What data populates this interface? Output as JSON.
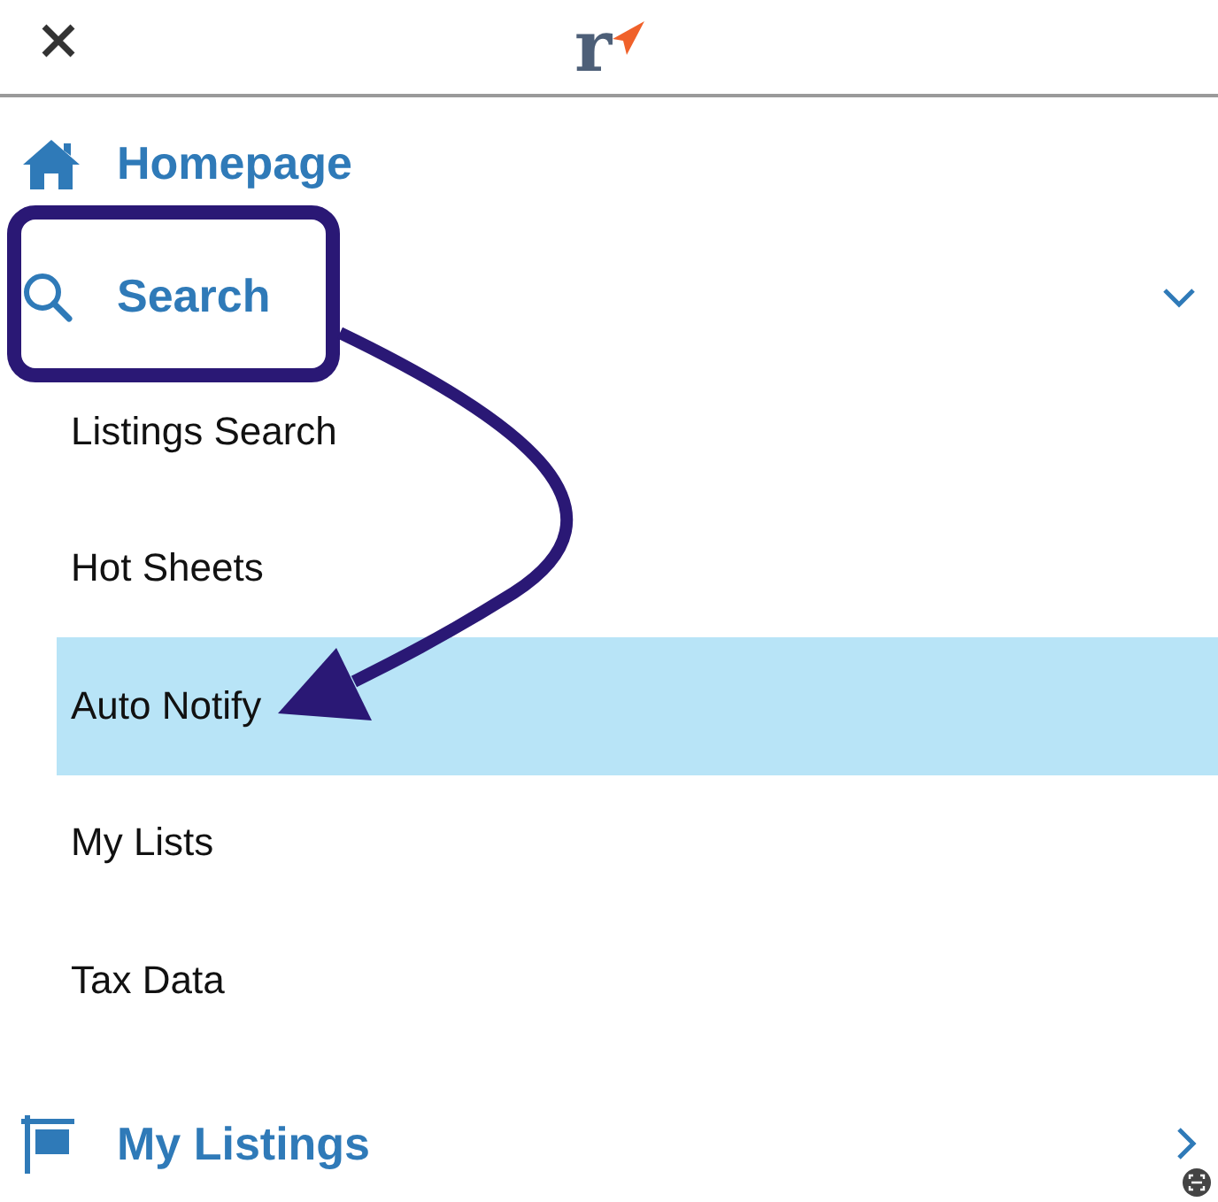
{
  "header": {
    "logo_text": "r"
  },
  "menu": [
    {
      "kind": "home",
      "label": "Homepage"
    },
    {
      "kind": "search",
      "label": "Search",
      "expanded": true,
      "children": [
        {
          "label": "Listings Search",
          "selected": false
        },
        {
          "label": "Hot Sheets",
          "selected": false
        },
        {
          "label": "Auto Notify",
          "selected": true
        },
        {
          "label": "My Lists",
          "selected": false
        },
        {
          "label": "Tax Data",
          "selected": false
        }
      ]
    },
    {
      "kind": "listings",
      "label": "My Listings",
      "expanded": false
    }
  ]
}
